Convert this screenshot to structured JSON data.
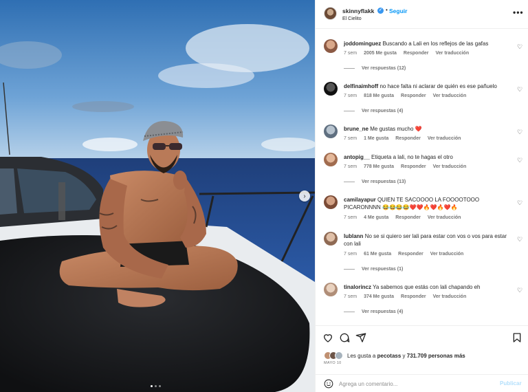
{
  "post": {
    "username": "skinnyflakk",
    "follow_label": "Seguir",
    "separator": "•",
    "location": "El Cielito",
    "more_label": "•••",
    "next_label": "›"
  },
  "comments": [
    {
      "user": "joddominguez",
      "text": "Buscando a Lali en los reflejos de las gafas",
      "time": "7 sem",
      "likes": "2005 Me gusta",
      "reply": "Responder",
      "translate": "Ver traducción",
      "view_replies": "Ver respuestas (12)"
    },
    {
      "user": "delfinaimhoff",
      "text": "no hace falta ni aclarar de quién es ese pañuelo",
      "time": "7 sem",
      "likes": "818 Me gusta",
      "reply": "Responder",
      "translate": "Ver traducción",
      "view_replies": "Ver respuestas (4)"
    },
    {
      "user": "brune_ne",
      "text": "Me gustas mucho ❤️",
      "time": "7 sem",
      "likes": "1 Me gusta",
      "reply": "Responder",
      "translate": "Ver traducción"
    },
    {
      "user": "antopig__",
      "text": "Etiqueta a lali, no te hagas el otro",
      "time": "7 sem",
      "likes": "778 Me gusta",
      "reply": "Responder",
      "translate": "Ver traducción",
      "view_replies": "Ver respuestas (13)"
    },
    {
      "user": "camilayapur",
      "text": "QUIEN TE SACOOOO LA FOOOOTOOO PICARONNNN 😂😂😂😂❤️❤️🔥❤️🔥❤️🔥",
      "time": "7 sem",
      "likes": "4 Me gusta",
      "reply": "Responder",
      "translate": "Ver traducción"
    },
    {
      "user": "lublann",
      "text": "No se si quiero ser lali para estar con vos o vos para estar con lali",
      "time": "7 sem",
      "likes": "61 Me gusta",
      "reply": "Responder",
      "translate": "Ver traducción",
      "view_replies": "Ver respuestas (1)"
    },
    {
      "user": "tinalorincz",
      "text": "Ya sabemos que estás con lali chapando eh",
      "time": "7 sem",
      "likes": "374 Me gusta",
      "reply": "Responder",
      "translate": "Ver traducción",
      "view_replies": "Ver respuestas (4)"
    }
  ],
  "likes": {
    "prefix": "Les gusta a",
    "first_user": "pecotass",
    "connector": "y",
    "others": "731.709 personas más"
  },
  "date": "MAYO 10",
  "add_comment": {
    "placeholder": "Agrega un comentario...",
    "publish_label": "Publicar"
  },
  "colors": {
    "accent": "#0095f6",
    "publish_disabled": "#b2dffc",
    "muted_text": "#737373"
  }
}
